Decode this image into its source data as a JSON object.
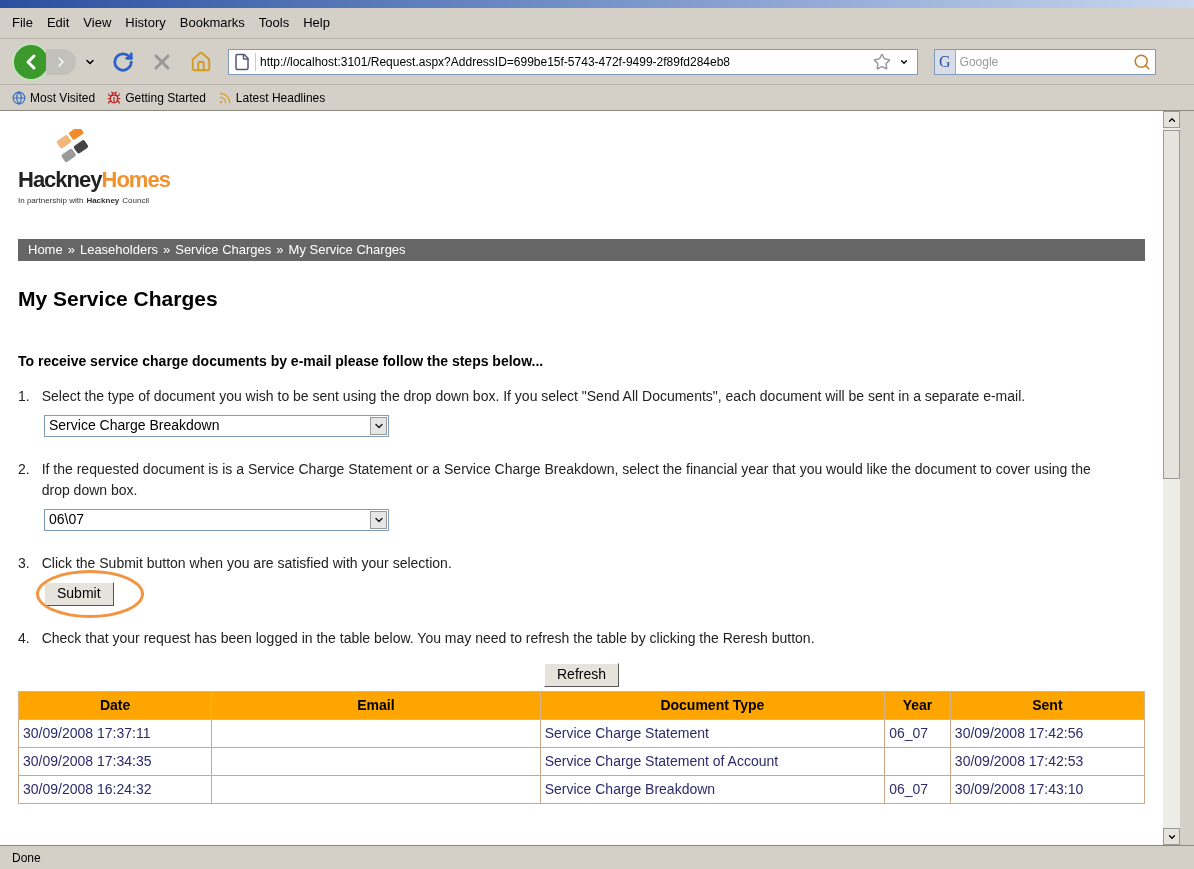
{
  "menu_bar": [
    "File",
    "Edit",
    "View",
    "History",
    "Bookmarks",
    "Tools",
    "Help"
  ],
  "address_bar": {
    "value": "http://localhost:3101/Request.aspx?AddressID=699be15f-5743-472f-9499-2f89fd284eb8"
  },
  "search": {
    "engine_letter": "G",
    "placeholder": "Google"
  },
  "bookmarks": [
    "Most Visited",
    "Getting Started",
    "Latest Headlines"
  ],
  "logo": {
    "name_dark": "Hackney",
    "name_light": "Homes",
    "tagline_start": "In partnership with",
    "tagline_brand": "Hackney",
    "tagline_end": "Council"
  },
  "breadcrumb": [
    "Home",
    "Leaseholders",
    "Service Charges",
    "My Service Charges"
  ],
  "breadcrumb_separator": "»",
  "heading": "My Service Charges",
  "intro": "To receive service charge documents by e-mail please follow the steps below...",
  "steps": [
    {
      "number": "1.",
      "text": "Select the type of document you wish to be sent using the drop down box. If you select \"Send All Documents\", each document will be sent in a separate e-mail.",
      "select": "Service Charge Breakdown"
    },
    {
      "number": "2.",
      "text": "If the requested document is is a Service Charge Statement or a Service Charge Breakdown, select the financial year that you would like the document to cover using the drop down box.",
      "select": "06\\07"
    },
    {
      "number": "3.",
      "text": "Click the Submit button when you are satisfied with your selection.",
      "button": "Submit",
      "highlighted": true
    },
    {
      "number": "4.",
      "text": "Check that your request has been logged in the table below. You may need to refresh the table by clicking the Reresh button."
    }
  ],
  "refresh_button": "Refresh",
  "table": {
    "columns": [
      "Date",
      "Email",
      "Document Type",
      "Year",
      "Sent"
    ],
    "rows": [
      [
        "30/09/2008 17:37:11",
        "",
        "Service Charge Statement",
        "06_07",
        "30/09/2008 17:42:56"
      ],
      [
        "30/09/2008 17:34:35",
        "",
        "Service Charge Statement of Account",
        "",
        "30/09/2008 17:42:53"
      ],
      [
        "30/09/2008 16:24:32",
        "",
        "Service Charge Breakdown",
        "06_07",
        "30/09/2008 17:43:10"
      ]
    ]
  },
  "status_bar": "Done"
}
